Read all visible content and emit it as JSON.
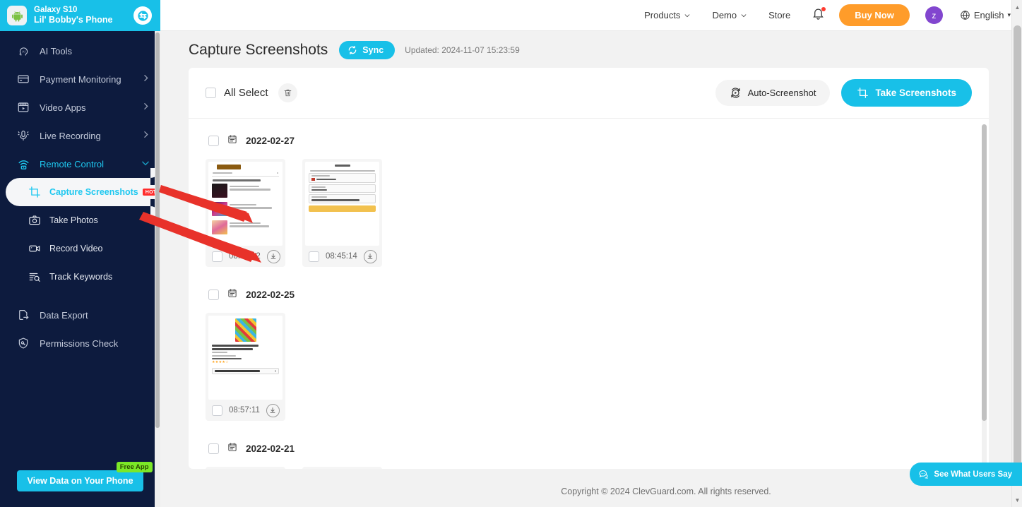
{
  "device": {
    "model": "Galaxy S10",
    "name": "Lil' Bobby's Phone",
    "avatar_icon": "android-robot-icon",
    "switch_icon": "switch-device-icon"
  },
  "sidebar": {
    "items": [
      {
        "label": "AI Tools",
        "icon": "ai-head-icon",
        "expandable": false,
        "state": "normal"
      },
      {
        "label": "Payment Monitoring",
        "icon": "credit-card-icon",
        "expandable": true,
        "state": "normal"
      },
      {
        "label": "Video Apps",
        "icon": "video-apps-icon",
        "expandable": true,
        "state": "normal"
      },
      {
        "label": "Live Recording",
        "icon": "microphone-icon",
        "expandable": true,
        "state": "normal"
      },
      {
        "label": "Remote Control",
        "icon": "remote-control-icon",
        "expandable": true,
        "state": "expanded"
      }
    ],
    "sub_items": [
      {
        "label": "Capture Screenshots",
        "icon": "crop-frame-icon",
        "badge": "HOT",
        "state": "active"
      },
      {
        "label": "Take Photos",
        "icon": "camera-icon",
        "badge": "",
        "state": "normal"
      },
      {
        "label": "Record Video",
        "icon": "video-camera-icon",
        "badge": "",
        "state": "normal"
      },
      {
        "label": "Track Keywords",
        "icon": "keyword-search-icon",
        "badge": "",
        "state": "normal"
      }
    ],
    "bottom_items": [
      {
        "label": "Data Export",
        "icon": "export-file-icon"
      },
      {
        "label": "Permissions Check",
        "icon": "shield-key-icon"
      }
    ],
    "cta": {
      "label": "View Data on Your Phone",
      "tag": "Free App"
    }
  },
  "topbar": {
    "links": [
      {
        "label": "Products",
        "caret": true
      },
      {
        "label": "Demo",
        "caret": true
      },
      {
        "label": "Store",
        "caret": false
      }
    ],
    "bell_icon": "notification-bell-icon",
    "buy_label": "Buy Now",
    "avatar_initial": "z",
    "language": "English",
    "globe_icon": "globe-icon"
  },
  "header": {
    "title": "Capture Screenshots",
    "sync_label": "Sync",
    "sync_icon": "sync-refresh-icon",
    "updated": "Updated: 2024-11-07 15:23:59"
  },
  "toolbar": {
    "all_select_label": "All Select",
    "trash_icon": "trash-icon",
    "auto_label": "Auto-Screenshot",
    "auto_icon": "auto-screenshot-icon",
    "take_label": "Take Screenshots",
    "take_icon": "crop-frame-icon"
  },
  "groups": [
    {
      "date": "2022-02-27",
      "calendar_icon": "calendar-icon",
      "items": [
        {
          "time": "08:57:12",
          "download_icon": "download-icon",
          "preview": "deals-recommended-list"
        },
        {
          "time": "08:45:14",
          "download_icon": "download-icon",
          "preview": "region-language-currency-settings"
        }
      ]
    },
    {
      "date": "2022-02-25",
      "calendar_icon": "calendar-icon",
      "items": [
        {
          "time": "08:57:11",
          "download_icon": "download-icon",
          "preview": "amazon-product-savings"
        }
      ]
    },
    {
      "date": "2022-02-21",
      "calendar_icon": "calendar-icon",
      "items": []
    }
  ],
  "footer": {
    "copyright": "Copyright © 2024 ClevGuard.com. All rights reserved.",
    "users_say_label": "See What Users Say",
    "users_say_icon": "chat-bubble-icon"
  },
  "colors": {
    "accent": "#18c0e8",
    "sidebar": "#0d1b3e",
    "buy": "#ff9c2a",
    "badge": "#ff2d2d",
    "free_tag": "#7ce827",
    "annotation": "#e8322a"
  }
}
